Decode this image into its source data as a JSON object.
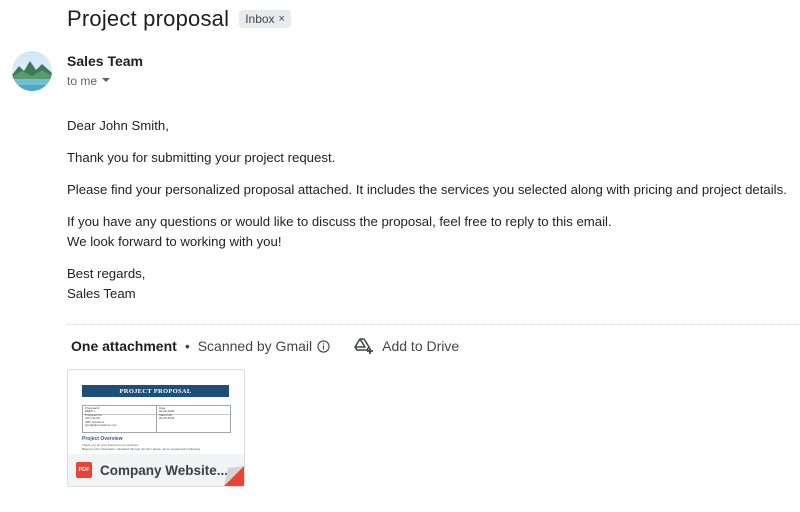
{
  "email": {
    "subject": "Project proposal",
    "label": "Inbox",
    "label_remove": "×",
    "sender": "Sales Team",
    "recipient": "to me"
  },
  "body": {
    "greeting": "Dear John Smith,",
    "p1": "Thank you for submitting your project request.",
    "p2": "Please find your personalized proposal attached. It includes the services you selected along with pricing and project details.",
    "p3_line1": "If you have any questions or would like to discuss the proposal, feel free to reply to this email.",
    "p3_line2": "We look forward to working with you!",
    "signoff_line1": "Best regards,",
    "signoff_line2": "Sales Team"
  },
  "attachments": {
    "count_label": "One attachment",
    "separator": "•",
    "scanned_label": "Scanned by Gmail",
    "add_to_drive_label": "Add to Drive",
    "file": {
      "type_badge": "PDF",
      "name": "Company Website...",
      "preview": {
        "title": "PROJECT PROPOSAL",
        "cell_left": "Proposal #\nREEF 1\nPrepared for:\nJohn Smith\nABC Solutions\njohn@abcsolutions.com",
        "cell_right": "Date:\n04-06-2025\nValid until:\n20-06-2025",
        "section": "Project Overview",
        "lines": "Thank you for your interest in our services.\nBased on the information submitted through the form below, we've prepared the following"
      }
    }
  },
  "icons": [
    "avatar-image",
    "dropdown-arrow-icon",
    "info-icon",
    "add-to-drive-icon",
    "pdf-icon"
  ],
  "colors": {
    "pdf_red": "#ea4335",
    "doc_title_blue": "#1f4e79",
    "chip_bg": "#e8eaed"
  }
}
